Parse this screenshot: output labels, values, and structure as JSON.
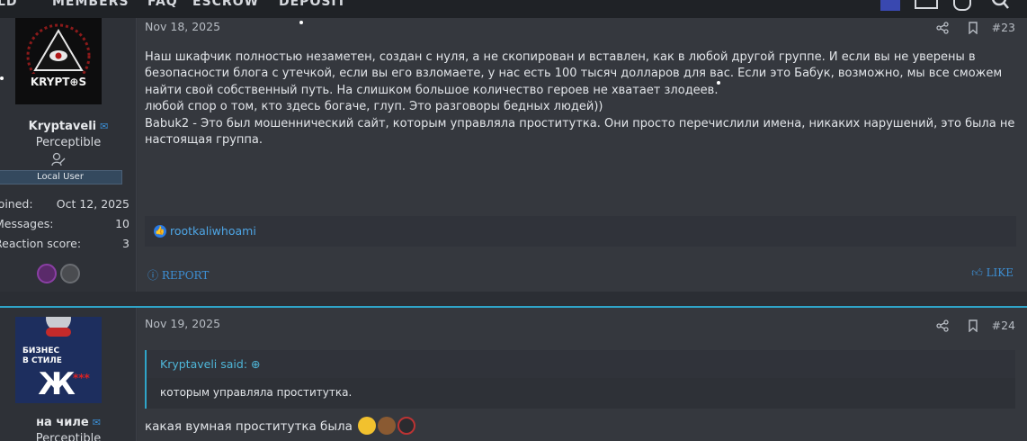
{
  "nav": {
    "items": [
      "LD",
      "MEMBERS",
      "FAQ",
      "ESCROW",
      "DEPOSIT"
    ]
  },
  "posts": [
    {
      "date": "Nov 18, 2025",
      "number": "#23",
      "user": {
        "name": "Kryptaveli",
        "rank": "Perceptible",
        "banner": "Local User",
        "avatar_text": "KRYPT⊕S",
        "stats": [
          {
            "key": "Joined:",
            "value": "Oct 12, 2025"
          },
          {
            "key": "Messages:",
            "value": "10"
          },
          {
            "key": "Reaction score:",
            "value": "3"
          }
        ]
      },
      "body": [
        "Наш шкафчик полностью незаметен, создан с нуля, а не скопирован и вставлен, как в любой другой группе. И если вы не уверены в безопасности блога с утечкой, если вы его взломаете, у нас есть 100 тысяч долларов для вас. Если это Бабук, возможно, мы все сможем найти свой собственный путь. На слишком большое количество героев не хватает злодеев.",
        "любой спор о том, кто здесь богаче, глуп. Это разговоры бедных людей))",
        "Babuk2 - Это был мошеннический сайт, которым управляла проститутка. Они просто перечислили имена, никаких нарушений, это была не настоящая группа."
      ],
      "reactions": "rootkaliwhoami",
      "report_label": "REPORT",
      "like_label": "LIKE"
    },
    {
      "date": "Nov 19, 2025",
      "number": "#24",
      "user": {
        "name": "на чиле",
        "rank": "Perceptible",
        "avatar_text": "БИЗНЕС В СТИЛЕ Ж"
      },
      "quote": {
        "author": "Kryptaveli said:",
        "text": "которым управляла проститутка."
      },
      "body": "какая вумная проститутка была"
    }
  ],
  "colors": {
    "accent": "#2fa4c8",
    "link": "#3d8fd4",
    "background": "#2b2e34"
  }
}
